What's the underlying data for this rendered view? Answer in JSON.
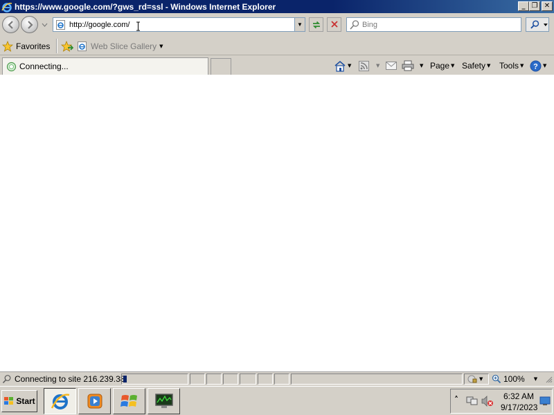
{
  "window": {
    "title": "https://www.google.com/?gws_rd=ssl - Windows Internet Explorer",
    "buttons": {
      "minimize": "_",
      "restore": "❐",
      "close": "✕"
    }
  },
  "nav": {
    "back_icon": "back-arrow-icon",
    "forward_icon": "forward-arrow-icon",
    "address_value": "http://google.com/",
    "refresh_icon": "refresh-icon",
    "stop_icon": "stop-icon",
    "search_placeholder": "Bing"
  },
  "favorites_bar": {
    "favorites_label": "Favorites",
    "web_slice_label": "Web Slice Gallery"
  },
  "tab": {
    "label": "Connecting..."
  },
  "command_bar": {
    "page_label": "Page",
    "safety_label": "Safety",
    "tools_label": "Tools"
  },
  "status": {
    "text": "Connecting to site 216.239.38.",
    "progress": 0.06,
    "zoom": "100%"
  },
  "taskbar": {
    "start_label": "Start",
    "apps": [
      "internet-explorer",
      "windows-media-player",
      "windows-explorer",
      "task-manager"
    ],
    "tray_arrow": "˄",
    "time": "6:32 AM",
    "date": "9/17/2023"
  },
  "colors": {
    "titlebar": "#0a246a",
    "chrome": "#d4d0c8",
    "content_bg": "#ffffff",
    "ie_blue": "#1e73c8"
  }
}
